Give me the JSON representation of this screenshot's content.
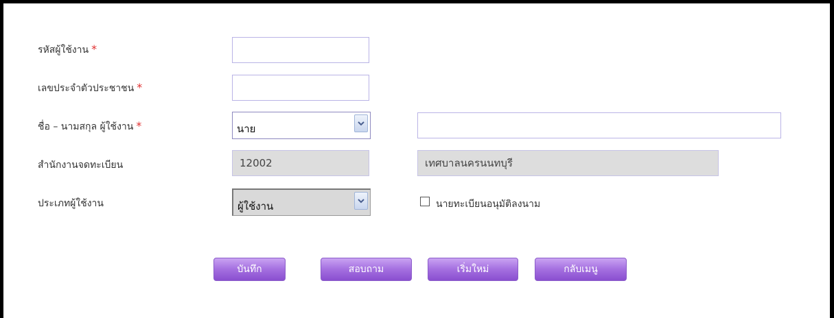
{
  "form": {
    "user_id": {
      "label": "รหัสผู้ใช้งาน",
      "required": "*",
      "value": ""
    },
    "citizen_id": {
      "label": "เลขประจำตัวประชาชน",
      "required": "*",
      "value": ""
    },
    "name": {
      "label": "ชื่อ – นามสกุล ผู้ใช้งาน",
      "required": "*",
      "title_selected": "นาย",
      "fullname_value": ""
    },
    "office": {
      "label": "สำนักงานจดทะเบียน",
      "code": "12002",
      "name": "เทศบาลนครนนทบุรี"
    },
    "user_type": {
      "label": "ประเภทผู้ใช้งาน",
      "selected": "ผู้ใช้งาน"
    },
    "approve_checkbox": {
      "label": "นายทะเบียนอนุมัติลงนาม",
      "checked": false
    }
  },
  "buttons": {
    "save": "บันทึก",
    "query": "สอบถาม",
    "reset": "เริ่มใหม่",
    "back_menu": "กลับเมนู"
  },
  "colors": {
    "required": "#e03030",
    "button": "#a46fe0",
    "field_border": "#b9b3e6",
    "readonly_bg": "#dddddd"
  }
}
